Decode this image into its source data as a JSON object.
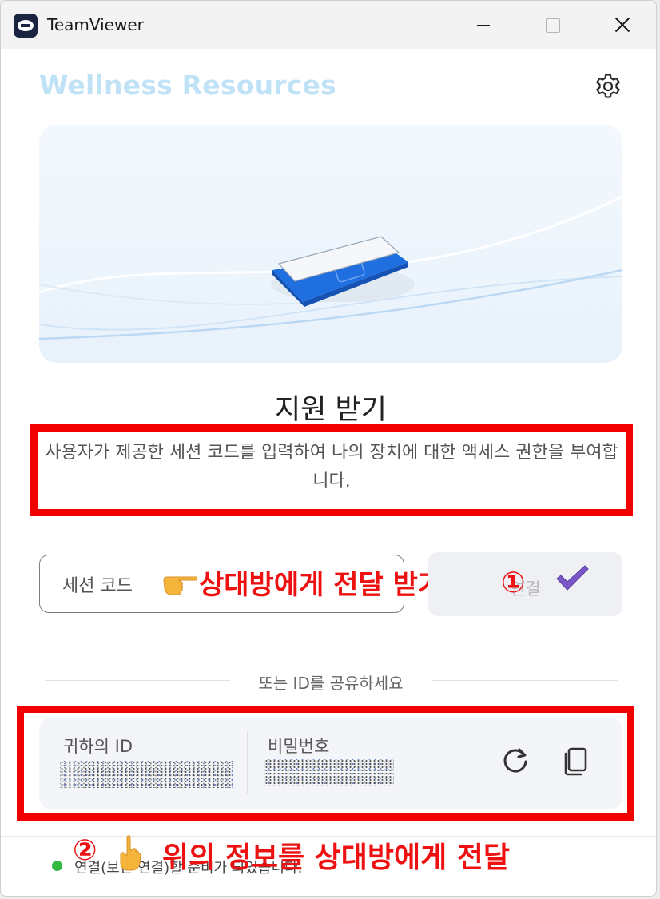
{
  "window": {
    "title": "TeamViewer"
  },
  "brand": "Wellness Resources",
  "main": {
    "heading": "지원 받기",
    "description": "사용자가 제공한 세션 코드를 입력하여 나의 장치에 대한 액세스 권한을 부여합니다."
  },
  "session": {
    "placeholder": "세션 코드",
    "connect_label": "연결"
  },
  "divider_text": "또는 ID를 공유하세요",
  "id_card": {
    "id_label": "귀하의 ID",
    "password_label": "비밀번호"
  },
  "status": {
    "text": "연결(보안 연결)할 준비가 되었습니다."
  },
  "annotations": {
    "step1_text": "상대방에게 전달 받기",
    "step1_number": "①",
    "step2_number": "②",
    "step2_text": "위의 정보를 상대방에게 전달"
  },
  "colors": {
    "annotation_red": "#f20000",
    "brand_light_blue": "#bfe2f6",
    "status_green": "#33b841"
  },
  "icons": [
    "app-logo-icon",
    "gear-icon",
    "check-icon",
    "pointing-hand-icon",
    "refresh-icon",
    "copy-icon"
  ]
}
